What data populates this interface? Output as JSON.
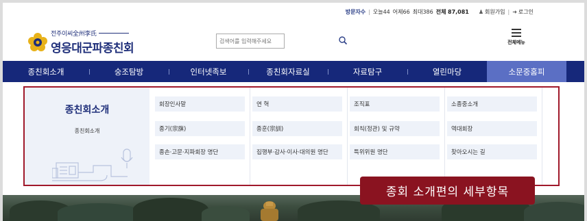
{
  "utility": {
    "visit_label": "방문자수",
    "today_label": "오늘",
    "today_value": "44",
    "yesterday_label": "어제",
    "yesterday_value": "66",
    "max_label": "최대",
    "max_value": "386",
    "total_label": "전체",
    "total_value": "87,081",
    "join_label": "회원가입",
    "login_label": "로그인"
  },
  "logo": {
    "subtitle": "전주이씨全州李氏",
    "title": "영응대군파종친회"
  },
  "search": {
    "placeholder": "검색어를 입력해주세요"
  },
  "allmenu": {
    "label": "전체메뉴"
  },
  "nav": {
    "items": [
      "종친회소개",
      "숭조탐방",
      "인터넷족보",
      "종친회자료실",
      "자료탐구",
      "열린마당",
      "소문중홈피"
    ]
  },
  "mega": {
    "title": "종친회소개",
    "subtitle": "종친회소개",
    "columns": [
      [
        "회장인사말",
        "종기(宗旗)",
        "종손·고문·지파회장 명단"
      ],
      [
        "연 혁",
        "종훈(宗訓)",
        "집행부·감사·이사·대의원 명단"
      ],
      [
        "조직표",
        "회칙(정관) 및 규약",
        "특위위원 명단"
      ],
      [
        "소종중소개",
        "역대회장",
        "찾아오시는 길"
      ]
    ]
  },
  "callout": {
    "text": "종회 소개편의 세부항목"
  },
  "colors": {
    "nav_bg": "#16287a",
    "nav_active": "#5b6fc4",
    "callout": "#8a1320",
    "brand": "#1f2f7a"
  }
}
